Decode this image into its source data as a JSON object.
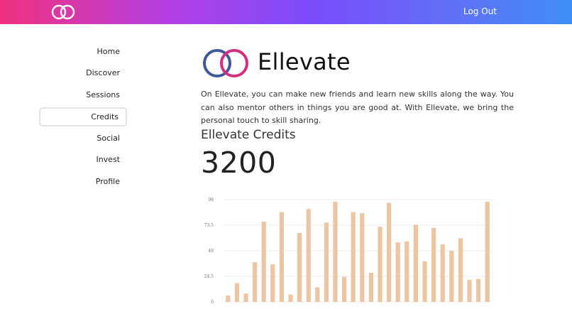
{
  "header": {
    "logout_label": "Log Out"
  },
  "sidebar": {
    "items": [
      {
        "label": "Home"
      },
      {
        "label": "Discover"
      },
      {
        "label": "Sessions"
      },
      {
        "label": "Credits"
      },
      {
        "label": "Social"
      },
      {
        "label": "Invest"
      },
      {
        "label": "Profile"
      }
    ],
    "active": "Credits"
  },
  "brand": {
    "name": "Ellevate"
  },
  "intro": "On Ellevate, you can make new friends and learn new skills along the way. You can also mentor others in things you are good at. With Ellevate, we bring the personal touch to skill sharing.",
  "credits": {
    "title": "Ellevate Credits",
    "value": "3200"
  },
  "colors": {
    "header_gradient": [
      "#f1317d",
      "#7a4dfb",
      "#3f8ef7"
    ],
    "bar": "#ecc5a2",
    "logo_blue": "#3d5a98",
    "logo_pink": "#d12e82"
  },
  "chart_data": {
    "type": "bar",
    "ylim": [
      0,
      98
    ],
    "yticks": [
      "0",
      "24.5",
      "49",
      "73.5",
      "98"
    ],
    "values": [
      6,
      18,
      8,
      38,
      77,
      36,
      86,
      7,
      66,
      89,
      14,
      76,
      96,
      24,
      86,
      85,
      28,
      72,
      95,
      57,
      58,
      74,
      39,
      71,
      55,
      49,
      61,
      21,
      22,
      96
    ],
    "grid": true
  }
}
